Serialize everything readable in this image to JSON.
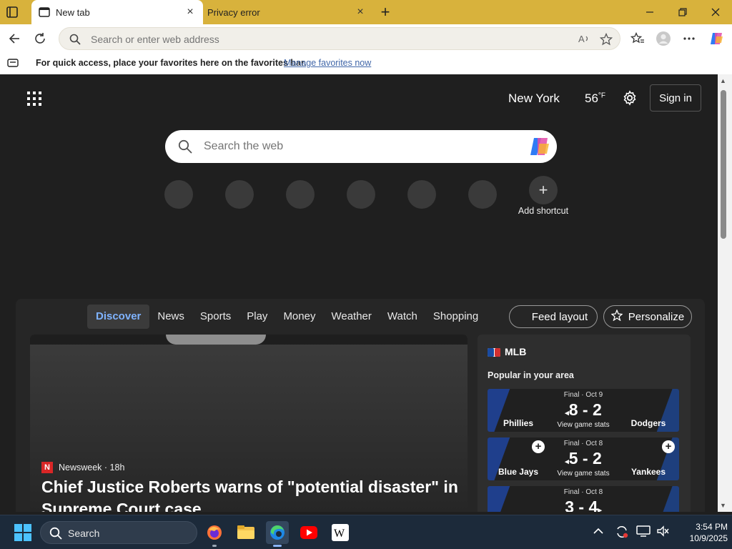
{
  "browser": {
    "tabs": [
      {
        "label": "New tab",
        "active": true
      },
      {
        "label": "Privacy error",
        "active": false
      }
    ],
    "address_placeholder": "Search or enter web address"
  },
  "favorites_bar": {
    "message": "For quick access, place your favorites here on the favorites bar.",
    "link": "Manage favorites now"
  },
  "newtab": {
    "city": "New York",
    "temperature": "56",
    "temp_unit": "°F",
    "sign_in": "Sign in",
    "search_placeholder": "Search the web",
    "add_shortcut": "Add shortcut",
    "nav": [
      "Discover",
      "News",
      "Sports",
      "Play",
      "Money",
      "Weather",
      "Watch",
      "Shopping"
    ],
    "feed_layout": "Feed layout",
    "personalize": "Personalize"
  },
  "article": {
    "source": "Newsweek",
    "age": "· 18h",
    "headline": "Chief Justice Roberts warns of \"potential disaster\" in Supreme Court case"
  },
  "mlb": {
    "title": "MLB",
    "subtitle": "Popular in your area",
    "games": [
      {
        "status": "Final · Oct 9",
        "score": "8 - 2",
        "stats": "View game stats",
        "home": "Phillies",
        "away": "Dodgers"
      },
      {
        "status": "Final · Oct 8",
        "score": "5 - 2",
        "stats": "View game stats",
        "home": "Blue Jays",
        "away": "Yankees"
      },
      {
        "status": "Final · Oct 8",
        "score": "3 - 4",
        "stats": "",
        "home": "",
        "away": ""
      }
    ]
  },
  "taskbar": {
    "search_label": "Search",
    "time": "3:54 PM",
    "date": "10/9/2025"
  },
  "colors": {
    "titlebar": "#d8b23c",
    "accent": "#7fb3ff",
    "taskbar": "#1c2a3a"
  }
}
